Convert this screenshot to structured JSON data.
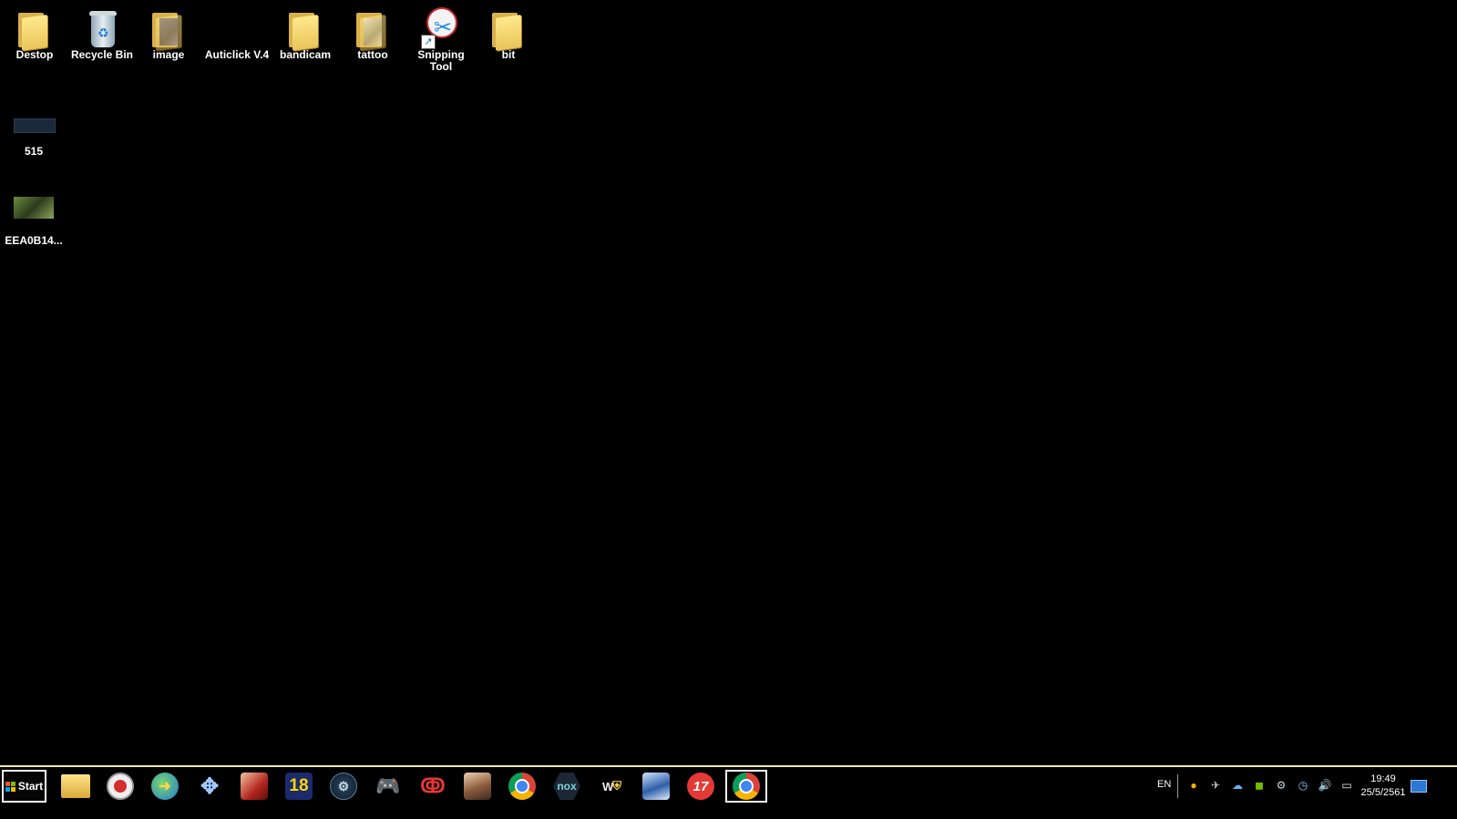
{
  "desktop": {
    "icons": [
      {
        "label": "Destop"
      },
      {
        "label": "Recycle Bin"
      },
      {
        "label": "image"
      },
      {
        "label": "Auticlick V.4"
      },
      {
        "label": "bandicam"
      },
      {
        "label": "tattoo"
      },
      {
        "label": "Snipping Tool"
      },
      {
        "label": "bit"
      },
      {
        "label": "515"
      },
      {
        "label": "EEA0B14..."
      }
    ]
  },
  "taskbar": {
    "start_label": "Start",
    "pinned": [
      {
        "name": "file-explorer",
        "icon": "folder-icon"
      },
      {
        "name": "screen-recorder",
        "icon": "record-icon"
      },
      {
        "name": "internet-download-manager",
        "icon": "globe-download-icon"
      },
      {
        "name": "psp-emulator",
        "icon": "psp-icon"
      },
      {
        "name": "game-app",
        "icon": "game-portrait-icon"
      },
      {
        "name": "game-18",
        "icon": "number-badge-icon",
        "text": "18"
      },
      {
        "name": "steam",
        "icon": "steam-icon"
      },
      {
        "name": "gamepad-app",
        "icon": "gamepad-icon"
      },
      {
        "name": "garena",
        "icon": "garena-icon"
      },
      {
        "name": "game-character-app",
        "icon": "character-icon"
      },
      {
        "name": "google-chrome",
        "icon": "chrome-icon"
      },
      {
        "name": "nox-player",
        "icon": "nox-icon",
        "text": "nox"
      },
      {
        "name": "wwe-game",
        "icon": "wwe-icon"
      },
      {
        "name": "fifa-game",
        "icon": "football-icon"
      },
      {
        "name": "pes-17",
        "icon": "pes17-icon",
        "text": "17"
      },
      {
        "name": "chrome-profile",
        "icon": "chrome-icon",
        "active": true
      }
    ],
    "language": "EN",
    "tray_icons": [
      "norton-icon",
      "network-off-icon",
      "cloud-icon",
      "nvidia-icon",
      "steam-tray-icon",
      "clock-tray-icon",
      "volume-icon",
      "network-icon"
    ],
    "time": "19:49",
    "date": "25/5/2561"
  },
  "colors": {
    "background": "#000000",
    "taskbar_border": "#f3e6a0",
    "folder": "#f5d97a"
  }
}
